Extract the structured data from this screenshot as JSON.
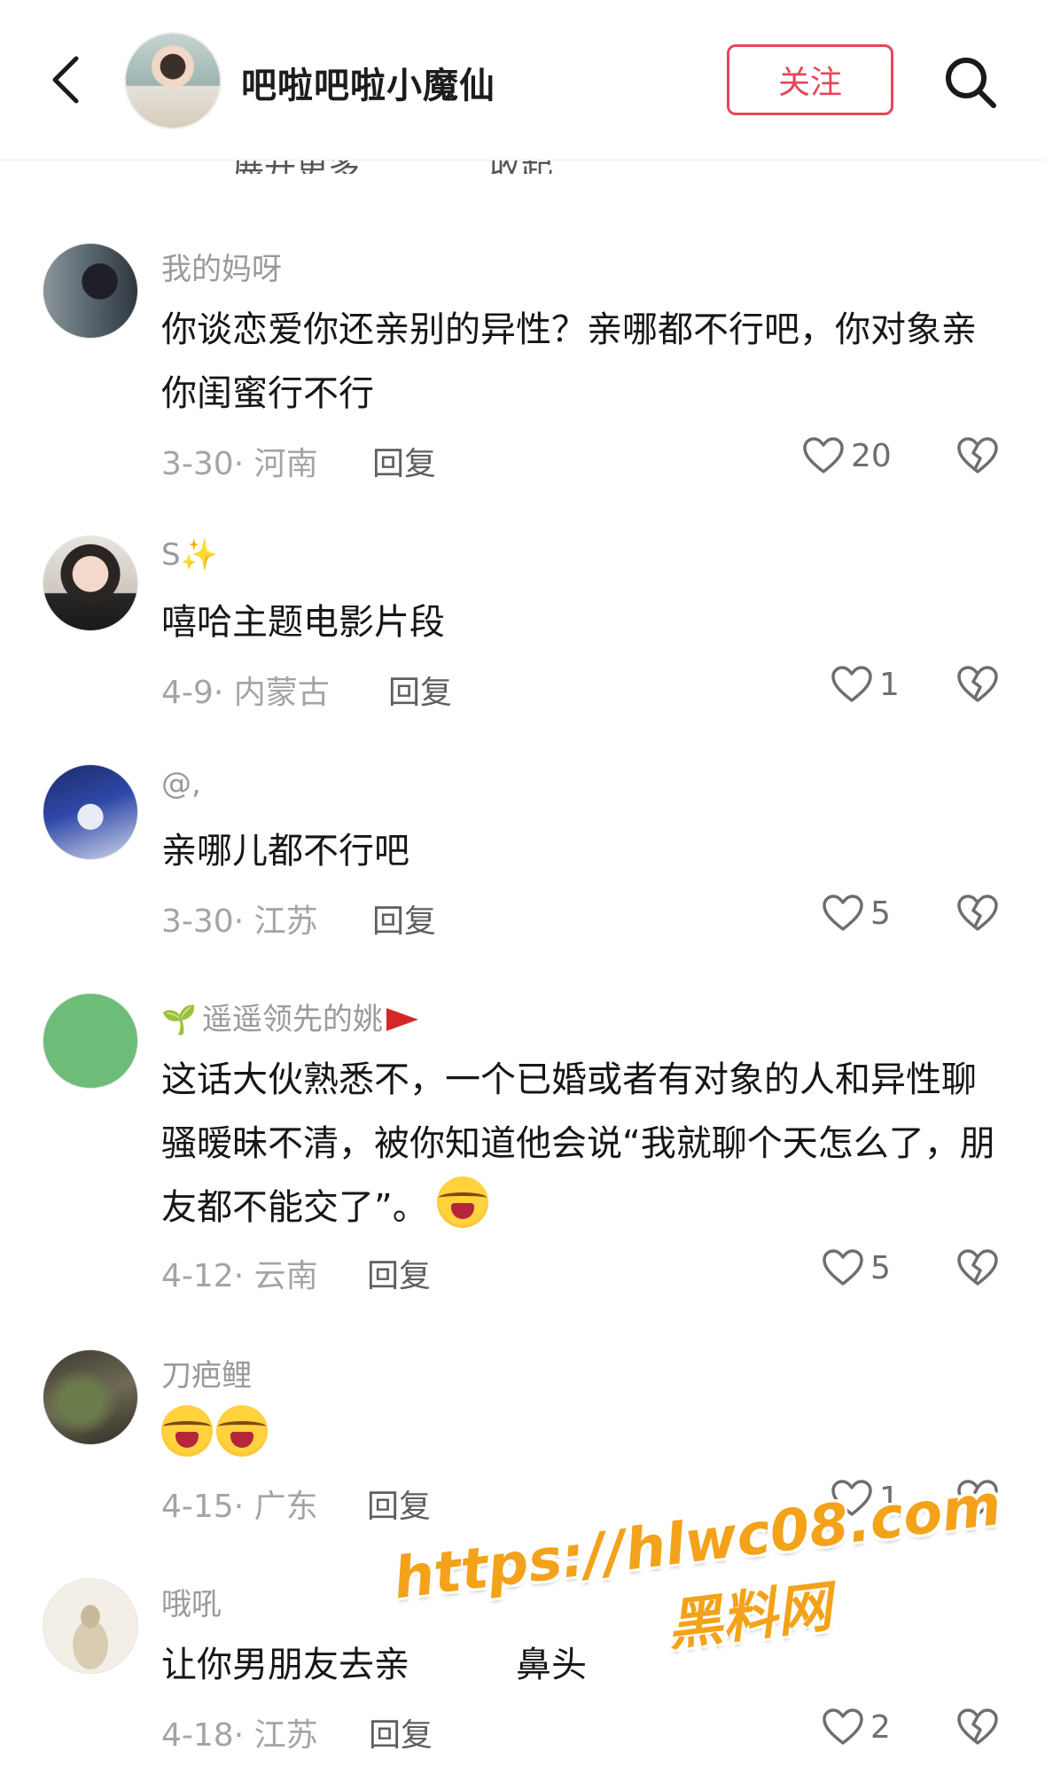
{
  "header": {
    "title": "吧啦吧啦小魔仙",
    "follow_label": "关注",
    "icons": {
      "back": "chevron-left-icon",
      "search": "search-icon"
    }
  },
  "partial_row": {
    "left": "展开更多",
    "right": "收起"
  },
  "comments": [
    {
      "user": "我的妈呀",
      "text": "你谈恋爱你还亲别的异性？亲哪都不行吧，你对象亲你闺蜜行不行",
      "date": "3-30",
      "location": "河南",
      "reply": "回复",
      "likes": "20"
    },
    {
      "user": "S✨",
      "text": "嘻哈主题电影片段",
      "date": "4-9",
      "location": "内蒙古",
      "reply": "回复",
      "likes": "1"
    },
    {
      "user": "@,",
      "text": "亲哪儿都不行吧",
      "date": "3-30",
      "location": "江苏",
      "reply": "回复",
      "likes": "5"
    },
    {
      "user": "遥遥领先的姚",
      "text": "这话大伙熟悉不，一个已婚或者有对象的人和异性聊骚暧昧不清，被你知道他会说“我就聊个天怎么了，朋友都不能交了”。",
      "date": "4-12",
      "location": "云南",
      "reply": "回复",
      "likes": "5"
    },
    {
      "user": "刀疤鲤",
      "text": "",
      "date": "4-15",
      "location": "广东",
      "reply": "回复",
      "likes": "1"
    },
    {
      "user": "哦吼",
      "text": "让你男朋友去亲",
      "text_tail": "鼻头",
      "date": "4-18",
      "location": "江苏",
      "reply": "回复",
      "likes": "2"
    }
  ],
  "watermark": {
    "url": "https://hlwc08.com",
    "site": "黑料网"
  },
  "colors": {
    "accent": "#e8455a",
    "muted": "#a4a4a4",
    "watermark": "#f3a21a"
  }
}
